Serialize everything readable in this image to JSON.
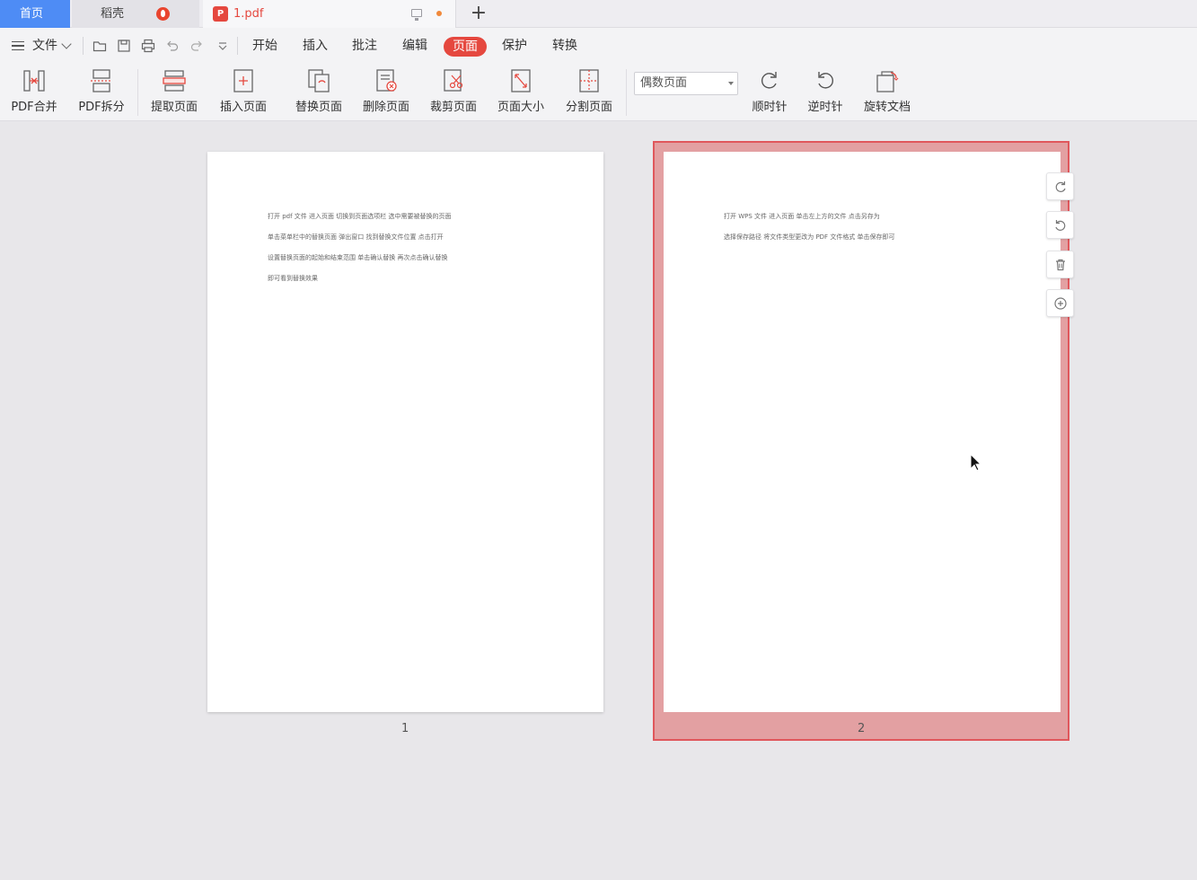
{
  "tabs": {
    "home": "首页",
    "daoke": "稻壳",
    "document": "1.pdf",
    "new_tab": "+"
  },
  "menu": {
    "file": "文件",
    "items": [
      "开始",
      "插入",
      "批注",
      "编辑",
      "页面",
      "保护",
      "转换"
    ],
    "active": "页面"
  },
  "ribbon": {
    "merge": "PDF合并",
    "split": "PDF拆分",
    "extract": "提取页面",
    "insert": "插入页面",
    "replace": "替换页面",
    "delete": "删除页面",
    "crop": "裁剪页面",
    "size": "页面大小",
    "divide": "分割页面",
    "page_filter": "偶数页面",
    "clockwise": "顺时针",
    "counterclockwise": "逆时针",
    "rotate_doc": "旋转文档"
  },
  "pages": [
    {
      "number": "1",
      "lines": [
        "打开 pdf 文件    进入页面    切换到页面选项栏    选中需要被替换的页面",
        "单击菜单栏中的替换页面    弹出窗口    找到替换文件位置    点击打开",
        "设置替换页面的起始和结束范围    单击确认替换    再次点击确认替换",
        "即可看到替换效果"
      ]
    },
    {
      "number": "2",
      "lines": [
        "打开 WPS 文件    进入页面    单击左上方的文件    点击另存为",
        "选择保存路径    将文件类型更改为 PDF 文件格式    单击保存即可"
      ]
    }
  ],
  "colors": {
    "accent_blue": "#4e8cf5",
    "accent_red": "#e5483f",
    "selection_fill": "#e3a0a2",
    "selection_border": "#e0575c"
  }
}
